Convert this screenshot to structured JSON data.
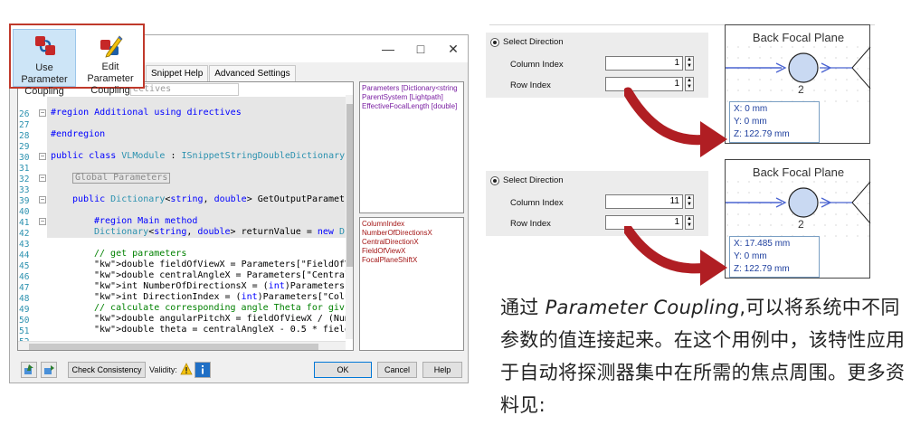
{
  "ribbon": {
    "use_button": {
      "line1": "Use Parameter",
      "line2": "Coupling",
      "icon": "use-parameter-coupling-icon"
    },
    "edit_button": {
      "line1": "Edit Parameter",
      "line2": "Coupling",
      "icon": "edit-parameter-coupling-icon"
    }
  },
  "dialog": {
    "window_controls": {
      "minimize": "—",
      "maximize": "□",
      "close": "✕"
    },
    "tabs": [
      "Snippet Help",
      "Advanced Settings"
    ],
    "code_search_text": "ectives",
    "code_lines": [
      {
        "n": "26",
        "text": ""
      },
      {
        "n": "27",
        "text": "#region Additional using directives"
      },
      {
        "n": "28",
        "text": ""
      },
      {
        "n": "29",
        "text": "#endregion"
      },
      {
        "n": "30",
        "text": ""
      },
      {
        "n": "31",
        "text": "public class VLModule : ISnippetStringDoubleDictionary"
      },
      {
        "n": "32",
        "text": ""
      },
      {
        "n": "33",
        "text": "Global Parameters"
      },
      {
        "n": "39",
        "text": ""
      },
      {
        "n": "40",
        "text": "public Dictionary<string, double> GetOutputParamet"
      },
      {
        "n": "41",
        "text": ""
      },
      {
        "n": "42",
        "text": "#region Main method"
      },
      {
        "n": "43",
        "text": "Dictionary<string, double> returnValue = new D"
      },
      {
        "n": "44",
        "text": ""
      },
      {
        "n": "45",
        "text": "// get parameters"
      },
      {
        "n": "46",
        "text": "double fieldOfViewX = Parameters[\"FieldOfViewX"
      },
      {
        "n": "47",
        "text": "double centralAngleX = Parameters[\"CentralDire"
      },
      {
        "n": "48",
        "text": "int NumberOfDirectionsX = (int)Parameters[\"Num"
      },
      {
        "n": "49",
        "text": "int DirectionIndex = (int)Parameters[\"ColumnIn"
      },
      {
        "n": "50",
        "text": "// calculate corresponding angle Theta for giv"
      },
      {
        "n": "51",
        "text": "double angularPitchX = fieldOfViewX / (NumberO"
      },
      {
        "n": "52",
        "text": "double theta = centralAngleX - 0.5 * fieldOfVi"
      }
    ],
    "top_list": [
      "Parameters [Dictionary<string",
      "ParentSystem [Lightpath]",
      "EffectiveFocalLength [double]"
    ],
    "bottom_list": [
      "ColumnIndex",
      "NumberOfDirectionsX",
      "CentralDirectionX",
      "FieldOfViewX",
      "FocalPlaneShiftX"
    ],
    "check_consistency": "Check Consistency",
    "validity_label": "Validity:",
    "ok": "OK",
    "cancel": "Cancel",
    "help": "Help"
  },
  "panels": [
    {
      "select_label": "Select Direction",
      "column_label": "Column Index",
      "column_value": "1",
      "row_label": "Row Index",
      "row_value": "1",
      "bfp_title": "Back Focal Plane",
      "bfp_number": "2",
      "x": "X: 0 mm",
      "y": "Y: 0 mm",
      "z": "Z: 122.79 mm"
    },
    {
      "select_label": "Select Direction",
      "column_label": "Column Index",
      "column_value": "11",
      "row_label": "Row Index",
      "row_value": "1",
      "bfp_title": "Back Focal Plane",
      "bfp_number": "2",
      "x": "X: 17.485 mm",
      "y": "Y: 0 mm",
      "z": "Z: 122.79 mm"
    }
  ],
  "description": {
    "prefix": "通过 ",
    "term": "Parameter Coupling",
    "rest": ",可以将系统中不同参数的值连接起来。在这个用例中，该特性应用于自动将探测器集中在所需的焦点周围。更多资料见:"
  },
  "colors": {
    "highlight_border": "#c0392b",
    "arrow": "#b01e23",
    "coord_text": "#1e3f9e"
  }
}
